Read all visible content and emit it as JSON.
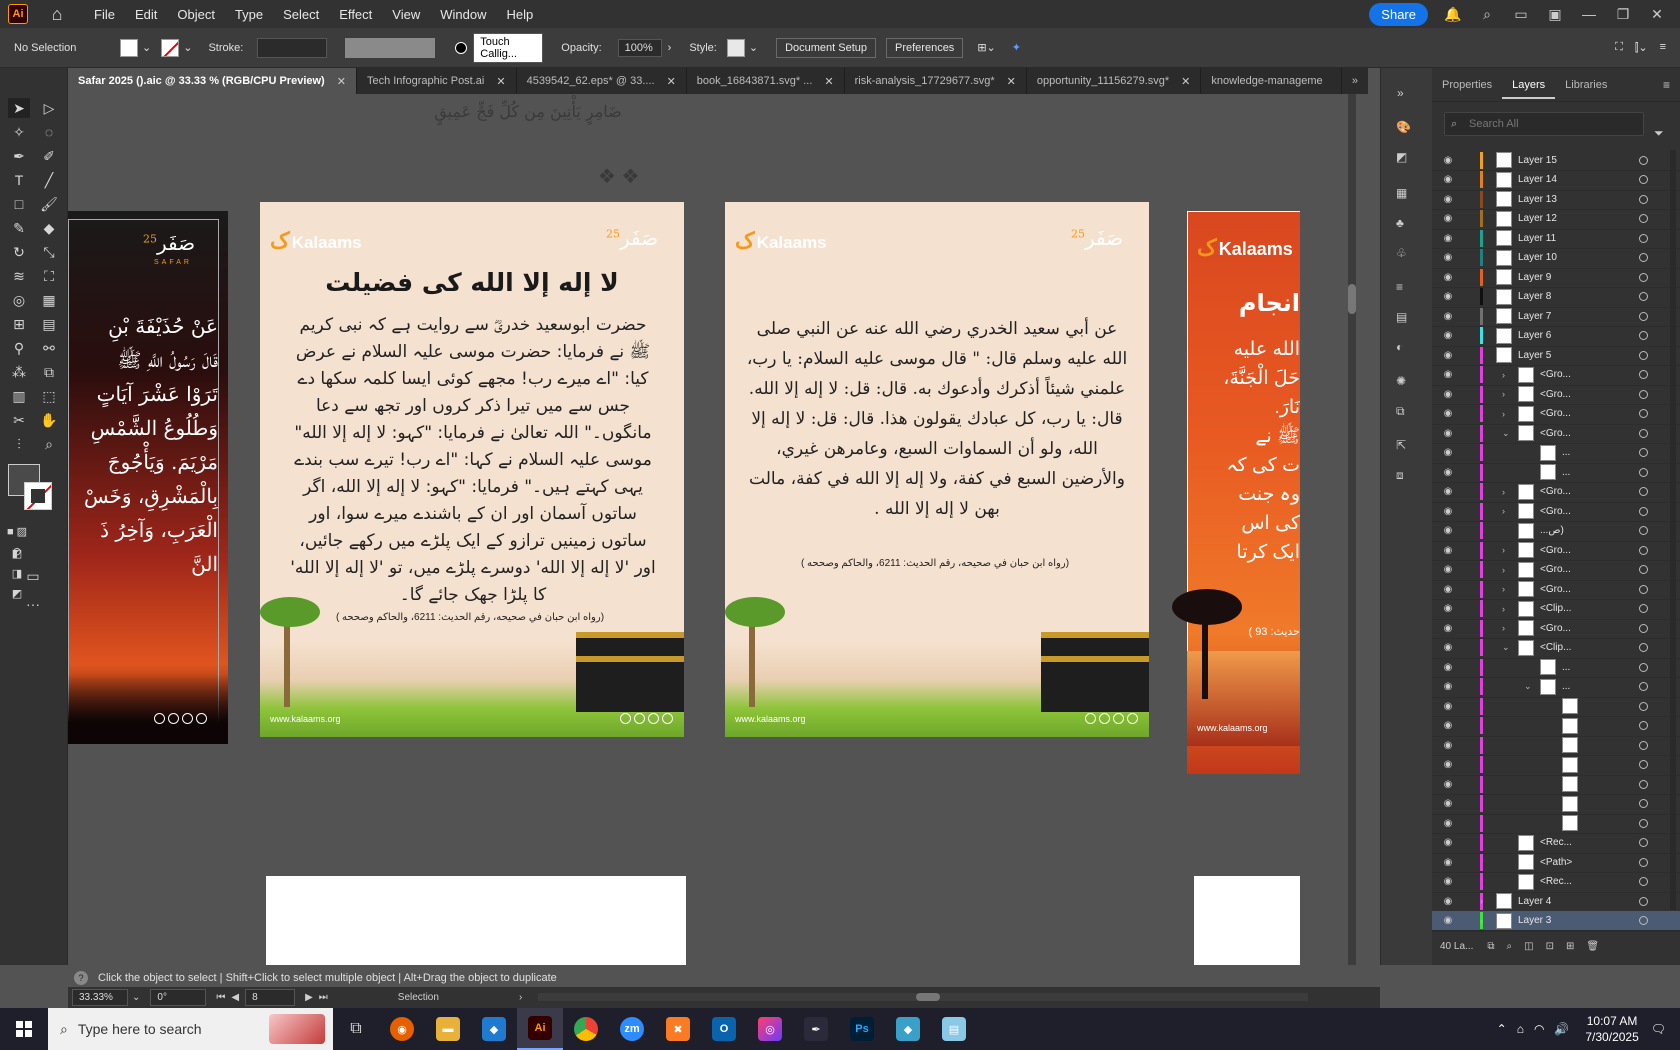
{
  "menubar": {
    "logo": "Ai",
    "items": [
      "File",
      "Edit",
      "Object",
      "Type",
      "Select",
      "Effect",
      "View",
      "Window",
      "Help"
    ],
    "share": "Share"
  },
  "controlbar": {
    "selection": "No Selection",
    "stroke_label": "Stroke:",
    "brush": "Touch Callig...",
    "opacity_label": "Opacity:",
    "opacity_value": "100%",
    "style_label": "Style:",
    "doc_setup": "Document Setup",
    "preferences": "Preferences"
  },
  "tabs": [
    {
      "label": "Safar 2025 ().aic @ 33.33 % (RGB/CPU Preview)",
      "active": true
    },
    {
      "label": "Tech Infographic Post.ai"
    },
    {
      "label": "4539542_62.eps* @ 33...."
    },
    {
      "label": "book_16843871.svg* ..."
    },
    {
      "label": "risk-analysis_17729677.svg*"
    },
    {
      "label": "opportunity_11156279.svg*"
    },
    {
      "label": "knowledge-manageme"
    }
  ],
  "canvas": {
    "bg_arabic_1": "ضَامِرٍ يَأْتِينَ مِن كُلِّ فَجٍّ عَمِيقٍ",
    "artboard1": {
      "safar": "صَفَر",
      "safar_num": "25",
      "safar_sub": "SAFAR",
      "lines": [
        "عَنْ حُذَيْفَةَ بْنِ",
        "قَالَ رَسُولُ اللَّهِ ﷺ",
        "تَرَوْا عَشْرَ آيَاتٍ",
        "وَطُلُوعُ الشَّمْسِ",
        "مَرْيَمَ. وَيَأْجُوجَ",
        "بِالْمَشْرِقِ، وَخَسْ",
        "الْعَرَبِ، وَآخِرُ ذَ",
        "النَّ"
      ]
    },
    "artboard2": {
      "brand": "Kalaams",
      "safar": "صَفَر",
      "safar_num": "25",
      "title": "لا إله إلا الله کی فضیلت",
      "body": "حضرت ابوسعید خدریؓ سے روایت ہے کہ نبی کریم ﷺ نے فرمایا: حضرت موسی علیہ السلام نے عرض کیا: \"اے میرے رب! مجھے کوئی ایسا کلمہ سکھا دے جس سے میں تیرا ذکر کروں اور تجھ سے دعا مانگوں۔\" اللہ تعالیٰ نے فرمایا: \"کہو: لا إله إلا الله\" موسی علیہ السلام نے کہا: \"اے رب! تیرے سب بندے یہی کہتے ہیں۔\" فرمایا: \"کہو: لا إله إلا الله، اگر ساتوں آسمان اور ان کے باشندے میرے سوا، اور ساتوں زمینیں ترازو کے ایک پلڑے میں رکھے جائیں، اور 'لا إله إلا الله' دوسرے پلڑے میں، تو 'لا إله إلا الله' کا پلڑا جھک جائے گا۔",
      "ref": "(رواه ابن حبان في صحيحه، رقم الحديث: 6211، والحاكم وصححه )",
      "url": "www.kalaams.org"
    },
    "artboard3": {
      "brand": "Kalaams",
      "safar": "صَفَر",
      "safar_num": "25",
      "body": "عن أبي سعيد الخدري رضي الله عنه عن النبي صلى الله عليه وسلم قال: \" قال موسى عليه السلام: يا رب، علمني شيئاً أذكرك وأدعوك به. قال: قل: لا إله إلا الله. قال: يا رب، كل عبادك يقولون هذا. قال: قل: لا إله إلا الله، ولو أن السماوات السبع، وعامرهن غيري، والأرضين السبع في كفة، ولا إله إلا الله في كفة، مالت بهن لا إله إلا الله .",
      "ref": "(رواه ابن حبان في صحيحه، رقم الحديث: 6211، والحاكم وصححه )",
      "url": "www.kalaams.org"
    },
    "artboard4": {
      "brand": "Kalaams",
      "title_part": "انجام",
      "lines": [
        "الله عليه",
        "حَلَ الْجَنَّةَ،",
        "نَارَ.",
        "ﷺ نے",
        "ت کی کہ",
        "وہ جنت",
        "کی اس",
        "ایک کرتا"
      ],
      "ref_part": "حدیث: 93 )",
      "url": "www.kalaams.org"
    }
  },
  "panel": {
    "tabs": [
      "Properties",
      "Layers",
      "Libraries"
    ],
    "active_tab": "Layers",
    "search_placeholder": "Search All",
    "layers": [
      {
        "name": "Layer 15",
        "color": "#f0a020",
        "indent": 0
      },
      {
        "name": "Layer 14",
        "color": "#e08020",
        "indent": 0
      },
      {
        "name": "Layer 13",
        "color": "#8a4a20",
        "indent": 0
      },
      {
        "name": "Layer 12",
        "color": "#a07020",
        "indent": 0
      },
      {
        "name": "Layer 11",
        "color": "#20a090",
        "indent": 0
      },
      {
        "name": "Layer 10",
        "color": "#208080",
        "indent": 0
      },
      {
        "name": "Layer 9",
        "color": "#e06020",
        "indent": 0
      },
      {
        "name": "Layer 8",
        "color": "#101010",
        "indent": 0
      },
      {
        "name": "Layer 7",
        "color": "#707070",
        "indent": 0
      },
      {
        "name": "Layer 6",
        "color": "#40e0e0",
        "indent": 0
      },
      {
        "name": "Layer 5",
        "color": "#e040e0",
        "indent": 0,
        "expanded": true
      },
      {
        "name": "<Gro...",
        "color": "#e040e0",
        "indent": 1,
        "arrow": "right"
      },
      {
        "name": "<Gro...",
        "color": "#e040e0",
        "indent": 1,
        "arrow": "right"
      },
      {
        "name": "<Gro...",
        "color": "#e040e0",
        "indent": 1,
        "arrow": "right"
      },
      {
        "name": "<Gro...",
        "color": "#e040e0",
        "indent": 1,
        "arrow": "down"
      },
      {
        "name": "...",
        "color": "#e040e0",
        "indent": 2
      },
      {
        "name": "...",
        "color": "#e040e0",
        "indent": 2
      },
      {
        "name": "<Gro...",
        "color": "#e040e0",
        "indent": 1,
        "arrow": "right"
      },
      {
        "name": "<Gro...",
        "color": "#e040e0",
        "indent": 1,
        "arrow": "right"
      },
      {
        "name": "...ص)",
        "color": "#e040e0",
        "indent": 1
      },
      {
        "name": "<Gro...",
        "color": "#e040e0",
        "indent": 1,
        "arrow": "right"
      },
      {
        "name": "<Gro...",
        "color": "#e040e0",
        "indent": 1,
        "arrow": "right"
      },
      {
        "name": "<Gro...",
        "color": "#e040e0",
        "indent": 1,
        "arrow": "right"
      },
      {
        "name": "<Clip...",
        "color": "#e040e0",
        "indent": 1,
        "arrow": "right"
      },
      {
        "name": "<Gro...",
        "color": "#e040e0",
        "indent": 1,
        "arrow": "right"
      },
      {
        "name": "<Clip...",
        "color": "#e040e0",
        "indent": 1,
        "arrow": "down"
      },
      {
        "name": "...",
        "color": "#e040e0",
        "indent": 2
      },
      {
        "name": "...",
        "color": "#e040e0",
        "indent": 2,
        "arrow": "down"
      },
      {
        "name": "",
        "color": "#e040e0",
        "indent": 3
      },
      {
        "name": "",
        "color": "#e040e0",
        "indent": 3
      },
      {
        "name": "",
        "color": "#e040e0",
        "indent": 3
      },
      {
        "name": "",
        "color": "#e040e0",
        "indent": 3
      },
      {
        "name": "",
        "color": "#e040e0",
        "indent": 3
      },
      {
        "name": "",
        "color": "#e040e0",
        "indent": 3
      },
      {
        "name": "",
        "color": "#e040e0",
        "indent": 3
      },
      {
        "name": "<Rec...",
        "color": "#e040e0",
        "indent": 1
      },
      {
        "name": "<Path>",
        "color": "#e040e0",
        "indent": 1
      },
      {
        "name": "<Rec...",
        "color": "#e040e0",
        "indent": 1
      },
      {
        "name": "Layer 4",
        "color": "#e040e0",
        "indent": 0,
        "arrow": "right"
      },
      {
        "name": "Layer 3",
        "color": "#40e040",
        "indent": 0,
        "arrow": "right",
        "selected": true
      }
    ],
    "layer_count": "40 La..."
  },
  "status": {
    "hint": "Click the object to select  |  Shift+Click to select multiple object  |  Alt+Drag the object to duplicate",
    "zoom": "33.33%",
    "rotation": "0°",
    "artboard_num": "8",
    "tool": "Selection"
  },
  "taskbar": {
    "search_placeholder": "Type here to search",
    "time": "10:07 AM",
    "date": "7/30/2025"
  }
}
